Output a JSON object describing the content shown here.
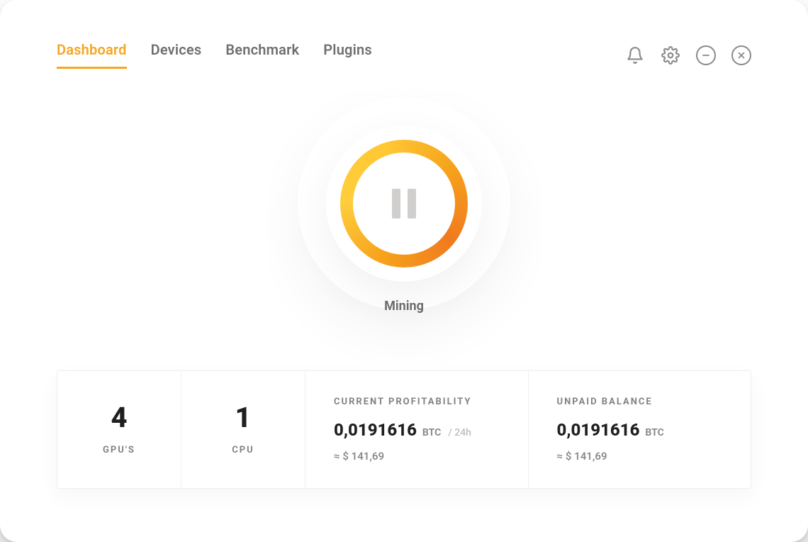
{
  "colors": {
    "accent": "#f5a623",
    "text_muted": "#6f6f6f",
    "text_dark": "#1f1f1f"
  },
  "tabs": [
    {
      "label": "Dashboard",
      "active": true
    },
    {
      "label": "Devices",
      "active": false
    },
    {
      "label": "Benchmark",
      "active": false
    },
    {
      "label": "Plugins",
      "active": false
    }
  ],
  "status": {
    "label": "Mining",
    "state": "running"
  },
  "cards": {
    "gpus": {
      "count": "4",
      "label": "GPU'S"
    },
    "cpu": {
      "count": "1",
      "label": "CPU"
    },
    "profitability": {
      "title": "CURRENT PROFITABILITY",
      "amount": "0,0191616",
      "unit": "BTC",
      "per": "/ 24h",
      "approx": "≈ $ 141,69"
    },
    "balance": {
      "title": "UNPAID BALANCE",
      "amount": "0,0191616",
      "unit": "BTC",
      "approx": "≈ $ 141,69"
    }
  }
}
